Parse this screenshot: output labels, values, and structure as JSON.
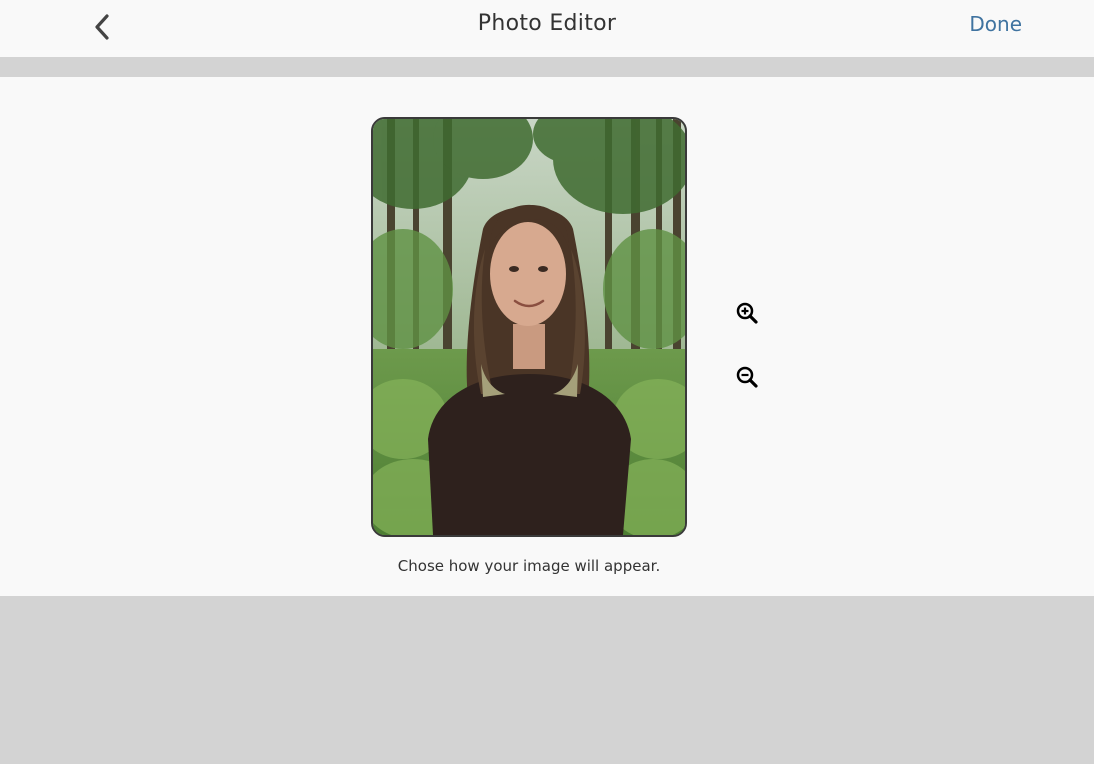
{
  "header": {
    "title": "Photo Editor",
    "done_label": "Done",
    "back_icon": "chevron-left-icon"
  },
  "editor": {
    "photo_description": "portrait-photo",
    "zoom_in_icon": "zoom-in-icon",
    "zoom_out_icon": "zoom-out-icon",
    "caption": "Chose how your image will appear."
  },
  "colors": {
    "accent": "#3f73a0",
    "background": "#f9f9f9",
    "band": "#d3d3d3",
    "text": "#333333"
  }
}
